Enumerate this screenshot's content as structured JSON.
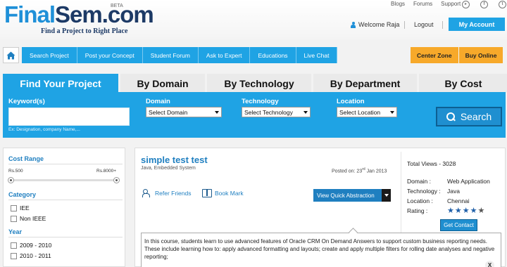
{
  "header": {
    "logo_part1": "Final",
    "logo_part2": "Sem.com",
    "beta": "BETA",
    "tagline": "Find a Project to Right Place",
    "top_links": [
      "Blogs",
      "Forums",
      "Support"
    ],
    "social_icons": [
      "youtube-icon",
      "facebook-icon",
      "twitter-icon"
    ],
    "welcome": "Welcome Raja",
    "logout": "Logout",
    "my_account": "My Account"
  },
  "nav": {
    "items": [
      "Search Project",
      "Post your Concept",
      "Student Forum",
      "Ask to Expert",
      "Educations",
      "Live Chat"
    ],
    "right": [
      "Center Zone",
      "Buy Online"
    ]
  },
  "tabs": [
    "Find Your Project",
    "By Domain",
    "By Technology",
    "By Department",
    "By Cost"
  ],
  "search": {
    "keyword_label": "Keyword(s)",
    "keyword_hint": "Ex: Designation, company Name,...",
    "domain_label": "Domain",
    "domain_value": "Select Domain",
    "technology_label": "Technology",
    "technology_value": "Select Technology",
    "location_label": "Location",
    "location_value": "Select Location",
    "button": "Search"
  },
  "sidebar": {
    "cost_range": "Cost Range",
    "cost_min": "Rs.500",
    "cost_max": "Rs.8000+",
    "category": "Category",
    "category_options": [
      "IEE",
      "Non IEEE"
    ],
    "year": "Year",
    "year_options": [
      "2009 - 2010",
      "2010 - 2011"
    ]
  },
  "result": {
    "title": "simple test test",
    "subtitle": "Java, Embedded System",
    "posted_prefix": "Posted on: 23",
    "posted_sup": "rd",
    "posted_suffix": " Jan 2013",
    "refer": "Refer Friends",
    "bookmark": "Book Mark",
    "quick_abstraction": "View Quick Abstraction",
    "total_views": "Total Views - 3028",
    "domain_key": "Domain :",
    "domain_val": "Web Application",
    "technology_key": "Technology :",
    "technology_val": "Java",
    "location_key": "Location :",
    "location_val": "Chennai",
    "rating_key": "Rating :",
    "rating_value": 4.5,
    "rating_max": 5,
    "contact": "Get Contact",
    "description": "In this course, students learn to use advanced features of Oracle CRM On Demand Answers to support custom business reporting needs. These include learning how to: apply advanced formatting and layouts; create and apply multiple filters for rolling date analyses and negative reporting;",
    "close": "X"
  }
}
